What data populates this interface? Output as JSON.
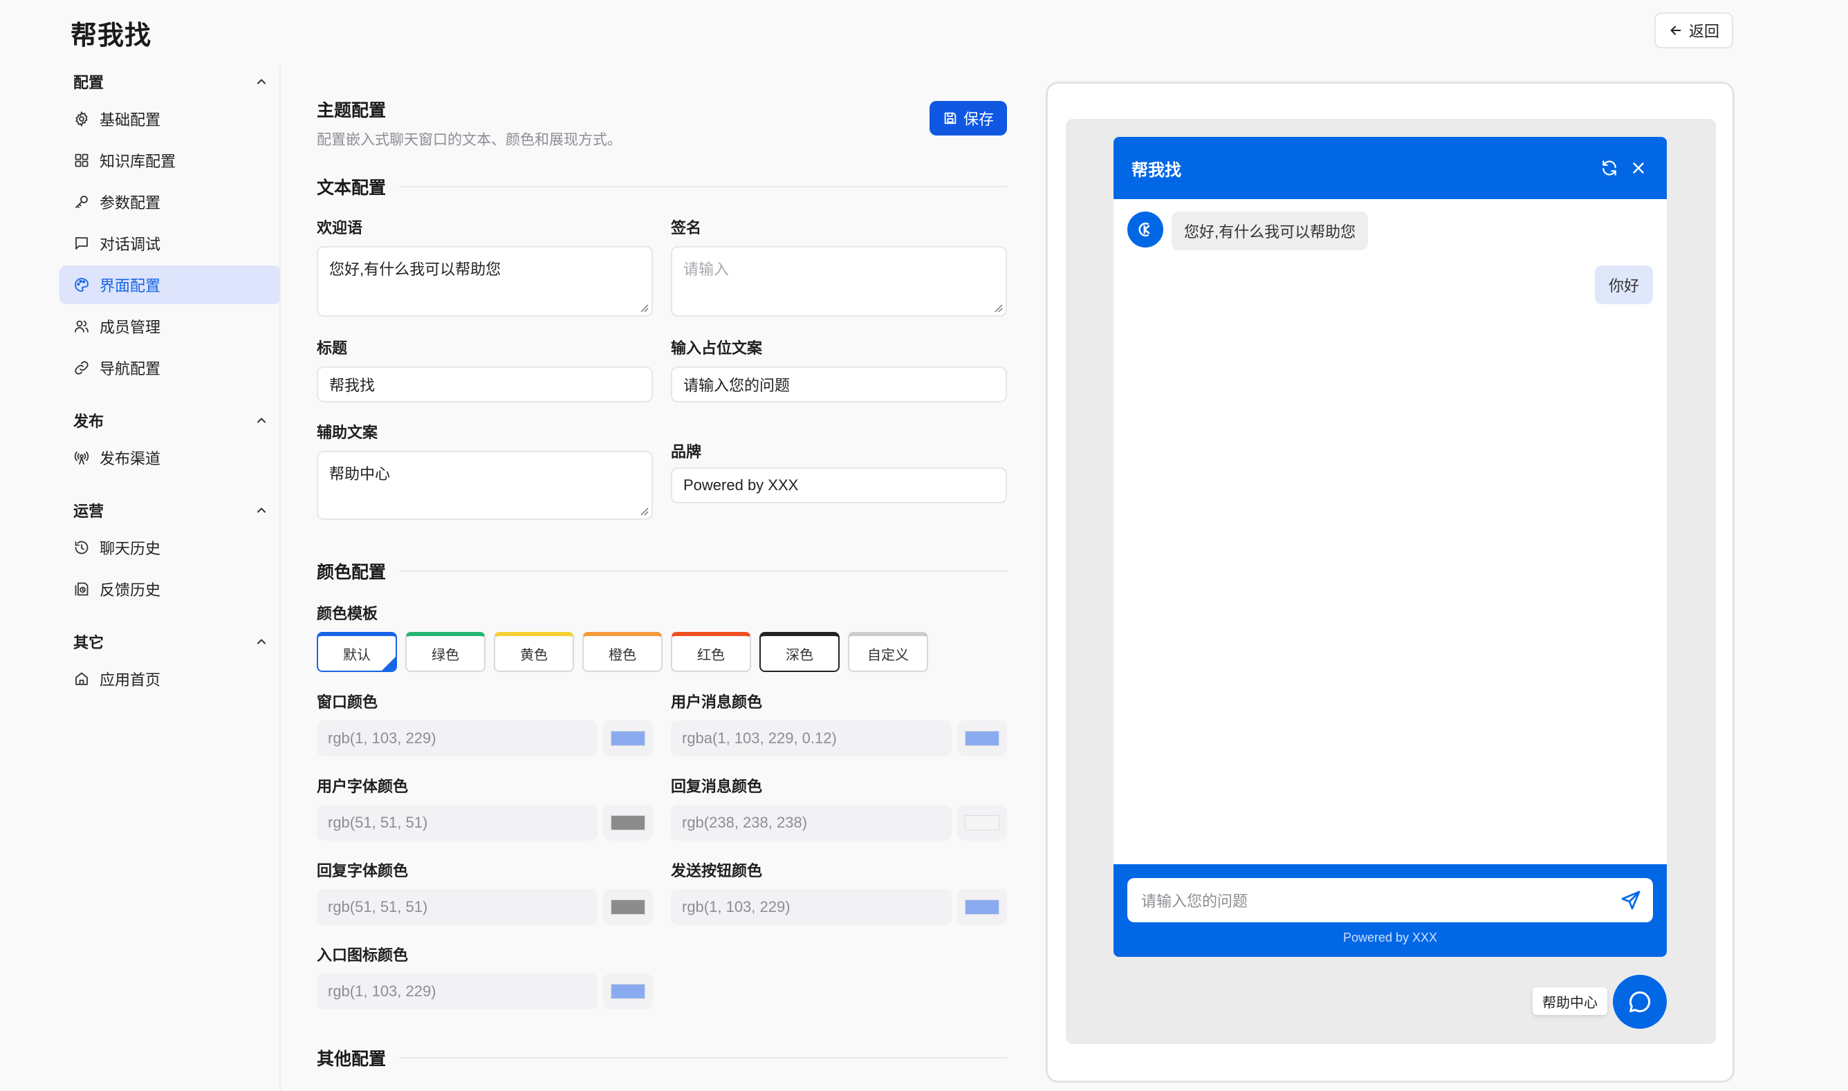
{
  "app": {
    "title": "帮我找",
    "back_label": "返回"
  },
  "sidebar": {
    "groups": [
      {
        "title": "配置",
        "items": [
          {
            "label": "基础配置",
            "icon": "gear-icon"
          },
          {
            "label": "知识库配置",
            "icon": "grid-icon"
          },
          {
            "label": "参数配置",
            "icon": "key-icon"
          },
          {
            "label": "对话调试",
            "icon": "message-square-icon"
          },
          {
            "label": "界面配置",
            "icon": "palette-icon",
            "active": true
          },
          {
            "label": "成员管理",
            "icon": "users-icon"
          },
          {
            "label": "导航配置",
            "icon": "link-icon"
          }
        ]
      },
      {
        "title": "发布",
        "items": [
          {
            "label": "发布渠道",
            "icon": "broadcast-icon"
          }
        ]
      },
      {
        "title": "运营",
        "items": [
          {
            "label": "聊天历史",
            "icon": "history-icon"
          },
          {
            "label": "反馈历史",
            "icon": "feedback-icon"
          }
        ]
      },
      {
        "title": "其它",
        "items": [
          {
            "label": "应用首页",
            "icon": "home-icon"
          }
        ]
      }
    ]
  },
  "main": {
    "title": "主题配置",
    "subtitle": "配置嵌入式聊天窗口的文本、颜色和展现方式。",
    "save_label": "保存",
    "text_section": {
      "title": "文本配置",
      "welcome": {
        "label": "欢迎语",
        "value": "您好,有什么我可以帮助您"
      },
      "signature": {
        "label": "签名",
        "placeholder": "请输入"
      },
      "title_field": {
        "label": "标题",
        "value": "帮我找"
      },
      "input_placeholder": {
        "label": "输入占位文案",
        "value": "请输入您的问题"
      },
      "aux": {
        "label": "辅助文案",
        "value": "帮助中心"
      },
      "brand": {
        "label": "品牌",
        "value": "Powered by XXX"
      }
    },
    "color_section": {
      "title": "颜色配置",
      "template_label": "颜色模板",
      "templates": [
        {
          "label": "默认",
          "color": "#1565e6",
          "selected": true
        },
        {
          "label": "绿色",
          "color": "#22b573"
        },
        {
          "label": "黄色",
          "color": "#f5d033"
        },
        {
          "label": "橙色",
          "color": "#f59a3d"
        },
        {
          "label": "红色",
          "color": "#f0501f"
        },
        {
          "label": "深色",
          "color": "#222222"
        },
        {
          "label": "自定义",
          "color": "#cccccc"
        }
      ],
      "fields": [
        {
          "label": "窗口颜色",
          "value": "rgb(1, 103, 229)",
          "swatch": "#8aabef"
        },
        {
          "label": "用户消息颜色",
          "value": "rgba(1, 103, 229, 0.12)",
          "swatch": "#8aabef"
        },
        {
          "label": "用户字体颜色",
          "value": "rgb(51, 51, 51)",
          "swatch": "#8c8c8c"
        },
        {
          "label": "回复消息颜色",
          "value": "rgb(238, 238, 238)",
          "swatch": "#f4f4f4"
        },
        {
          "label": "回复字体颜色",
          "value": "rgb(51, 51, 51)",
          "swatch": "#8c8c8c"
        },
        {
          "label": "发送按钮颜色",
          "value": "rgb(1, 103, 229)",
          "swatch": "#8aabef"
        },
        {
          "label": "入口图标颜色",
          "value": "rgb(1, 103, 229)",
          "swatch": "#8aabef"
        }
      ]
    },
    "other_section": {
      "title": "其他配置"
    }
  },
  "preview": {
    "header_title": "帮我找",
    "bot_message": "您好,有什么我可以帮助您",
    "user_message": "你好",
    "input_placeholder": "请输入您的问题",
    "brand": "Powered by XXX",
    "help_tag": "帮助中心",
    "accent": "#0167e5"
  }
}
